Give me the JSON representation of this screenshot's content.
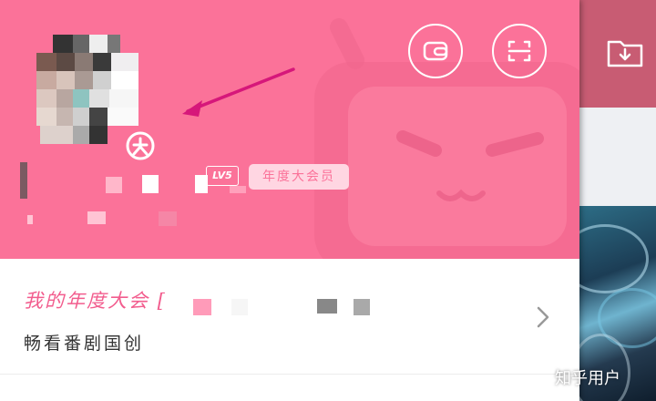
{
  "colors": {
    "brand_pink": "#fb7299",
    "promo_title": "#f25d8e",
    "arrow": "#d6177a",
    "badge_bg": "#ffd6e2"
  },
  "header": {
    "level_badge": "LV5",
    "vip_badge": "年度大会员"
  },
  "toolbar": {
    "wallet_icon": "wallet-icon",
    "scan_icon": "scan-icon"
  },
  "promo": {
    "title": "我的年度大会 [",
    "subtitle": "畅看番剧国创"
  },
  "watermark": "知乎用户"
}
